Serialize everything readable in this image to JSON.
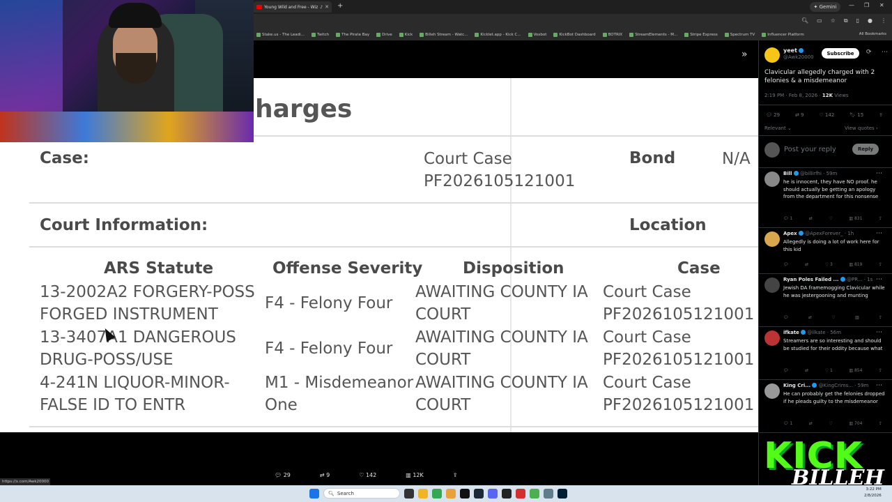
{
  "browser": {
    "tab_title": "Young Wild and Free - Wiz",
    "gemini_label": "Gemini",
    "bookmarks": [
      "Stake.us - The Leadi...",
      "Twitch",
      "The Pirate Bay",
      "Drive",
      "Kick",
      "Billeh Stream - Watc...",
      "Kicklet.app - Kick C...",
      "Voxbot",
      "KickBot Dashboard",
      "BOTRIX",
      "StreamElements - M...",
      "Stripe Express",
      "Spectrum TV",
      "Influencer Platform"
    ],
    "all_bookmarks": "All Bookmarks",
    "status_url": "https://x.com/Awk20000"
  },
  "document": {
    "heading": "harges",
    "case_label": "Case:",
    "case_value_line1": "Court Case",
    "case_value_line2": "PF2026105121001",
    "bond_label": "Bond",
    "bond_value": "N/A",
    "court_info_label": "Court Information:",
    "location_label": "Location",
    "columns": [
      "ARS Statute",
      "Offense Severity",
      "Disposition",
      "Case"
    ],
    "rows": [
      {
        "statute": [
          "13-2002A2 FORGERY-POSS",
          "FORGED INSTRUMENT"
        ],
        "severity": [
          "F4 - Felony Four"
        ],
        "disposition": [
          "AWAITING COUNTY IA",
          "COURT"
        ],
        "case": [
          "Court Case",
          "PF2026105121001"
        ]
      },
      {
        "statute": [
          "13-3407A1 DANGEROUS",
          "DRUG-POSS/USE"
        ],
        "severity": [
          "F4 - Felony Four"
        ],
        "disposition": [
          "AWAITING COUNTY IA",
          "COURT"
        ],
        "case": [
          "Court Case",
          "PF2026105121001"
        ]
      },
      {
        "statute": [
          "4-241N LIQUOR-MINOR-",
          "FALSE ID TO ENTR"
        ],
        "severity": [
          "M1 - Misdemeanor",
          "One"
        ],
        "disposition": [
          "AWAITING COUNTY IA",
          "COURT"
        ],
        "case": [
          "Court Case",
          "PF2026105121001"
        ]
      }
    ]
  },
  "post": {
    "name": "yeet",
    "handle": "@Awk20000",
    "subscribe": "Subscribe",
    "text": "Clavicular allegedly charged with 2 felonies & a misdemeanor",
    "time": "2:19 PM · Feb 8, 2026 · ",
    "views_count": "12K",
    "views_label": " Views",
    "stats": {
      "replies": "29",
      "reposts": "9",
      "likes": "142",
      "bookmarks": "15"
    },
    "sort": "Relevant",
    "view_quotes": "View quotes",
    "reply_placeholder": "Post your reply",
    "reply_button": "Reply"
  },
  "replies": [
    {
      "name": "Bill",
      "meta": "@billirfhi · 59m",
      "text": "he is innocent, they have NO proof. he should actually be getting an apology from the department for this nonsense",
      "replies": "1",
      "likes": "",
      "views": "831"
    },
    {
      "name": "Apex",
      "meta": "@ApexForever_ · 1h",
      "text": "Allegedly is doing a lot of work here for this kid",
      "replies": "",
      "likes": "3",
      "views": "819"
    },
    {
      "name": "Ryan Poles Failed ...",
      "meta": "@PR... · 1s",
      "text": "Jewish DA framemogging Clavicular while he was jestergooning and munting",
      "replies": "",
      "likes": "",
      "views": ""
    },
    {
      "name": "ifkate",
      "meta": "@ilkate · 56m",
      "text": "Streamers are so interesting and should be studied for their oddity because what",
      "replies": "",
      "likes": "1",
      "views": "854"
    },
    {
      "name": "King Cri...",
      "meta": "@KingCrims... · 59m",
      "text": "He can probably get the felonies dropped if he pleads guilty to the misdemeanor",
      "replies": "1",
      "likes": "",
      "views": "704"
    }
  ],
  "bottom_stats": {
    "replies": "29",
    "reposts": "9",
    "likes": "142",
    "views": "12K"
  },
  "overlay": {
    "kick": "KICK",
    "billeh": "BILLEH"
  },
  "taskbar": {
    "search": "Search",
    "time": "3:22 PM",
    "date": "2/8/2026"
  },
  "colors": {
    "kick_green": "#53fc18",
    "x_blue": "#1d9bf0"
  }
}
